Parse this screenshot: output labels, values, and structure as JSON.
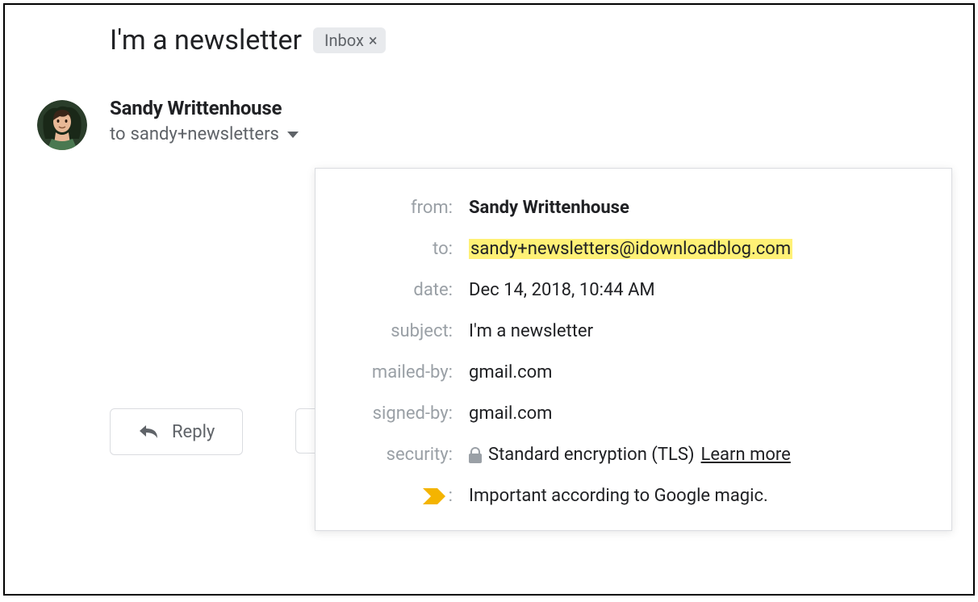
{
  "subject": "I'm a newsletter",
  "inbox_tag": "Inbox",
  "sender": {
    "name": "Sandy Writtenhouse",
    "to_prefix": "to",
    "to_alias": "sandy+newsletters"
  },
  "reply_label": "Reply",
  "details": {
    "labels": {
      "from": "from:",
      "to": "to:",
      "date": "date:",
      "subject": "subject:",
      "mailed_by": "mailed-by:",
      "signed_by": "signed-by:",
      "security": "security:"
    },
    "from": "Sandy Writtenhouse",
    "to": "sandy+newsletters@idownloadblog.com",
    "date": "Dec 14, 2018, 10:44 AM",
    "subject": "I'm a newsletter",
    "mailed_by": "gmail.com",
    "signed_by": "gmail.com",
    "security_text": "Standard encryption (TLS)",
    "security_learn_more": "Learn more",
    "importance": "Important according to Google magic."
  }
}
